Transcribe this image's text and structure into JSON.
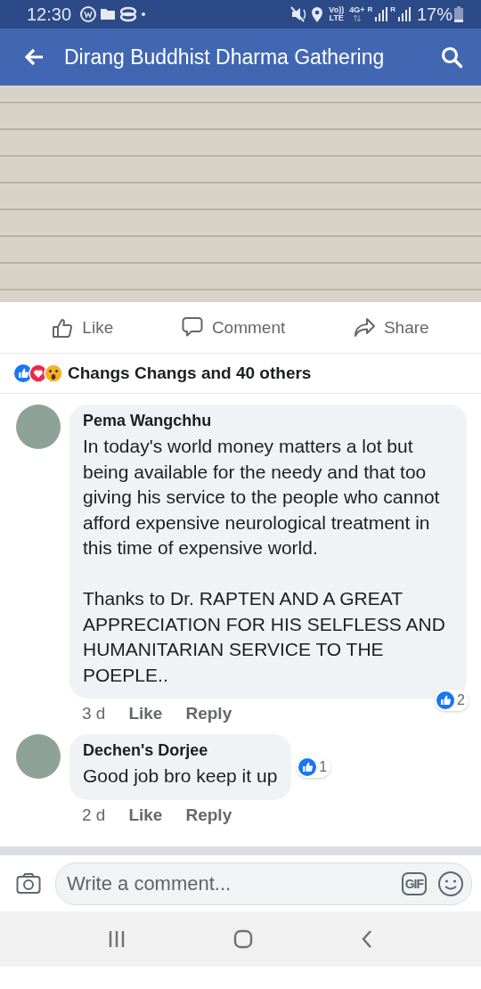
{
  "status_bar": {
    "time": "12:30",
    "volte": "Vo))",
    "lte": "LTE",
    "network": "4G+",
    "roaming": [
      "R",
      "R"
    ],
    "battery": "17%"
  },
  "app_bar": {
    "title": "Dirang Buddhist Dharma Gathering"
  },
  "post": {
    "actions": [
      {
        "kind": "like",
        "label": "Like"
      },
      {
        "kind": "comment",
        "label": "Comment"
      },
      {
        "kind": "share",
        "label": "Share"
      }
    ],
    "reactions": {
      "summary": "Changs Changs and 40 others"
    }
  },
  "comments": [
    {
      "kind": "long",
      "author": "Pema Wangchhu",
      "paragraphs": [
        "In today's world money matters a lot but being available for the needy and that too giving his service to the people who cannot afford expensive neurological treatment in this time of expensive world.",
        "Thanks to Dr. RAPTEN AND A GREAT APPRECIATION FOR HIS SELFLESS AND HUMANITARIAN SERVICE TO THE POEPLE.."
      ],
      "time": "3 d",
      "like": "Like",
      "reply": "Reply",
      "reaction_count": "2"
    },
    {
      "kind": "short",
      "author": "Dechen's Dorjee",
      "paragraphs": [
        "Good job bro keep it up"
      ],
      "time": "2 d",
      "like": "Like",
      "reply": "Reply",
      "reaction_count": "1"
    }
  ],
  "composer": {
    "placeholder": "Write a comment...",
    "gif": "GIF"
  }
}
